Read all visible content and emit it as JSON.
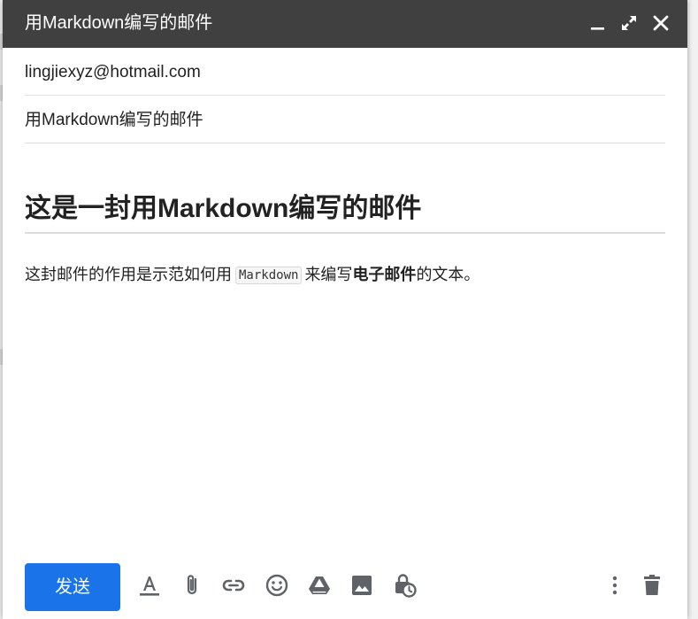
{
  "window": {
    "title": "用Markdown编写的邮件"
  },
  "controls": {
    "minimize_icon": "minimize-icon",
    "expand_icon": "expand-icon",
    "close_icon": "close-icon"
  },
  "fields": {
    "recipient": "lingjiexyz@hotmail.com",
    "subject": "用Markdown编写的邮件"
  },
  "body": {
    "heading": "这是一封用Markdown编写的邮件",
    "paragraph_before_code": "这封邮件的作用是示范如何用",
    "inline_code": "Markdown",
    "paragraph_middle": "来编写",
    "paragraph_bold": "电子邮件",
    "paragraph_after": "的文本。"
  },
  "toolbar": {
    "send_label": "发送",
    "icons": [
      "format-text-icon",
      "attach-icon",
      "link-icon",
      "emoji-icon",
      "drive-icon",
      "image-icon",
      "confidential-mode-icon",
      "more-options-icon",
      "trash-icon"
    ]
  },
  "colors": {
    "titlebar": "#404040",
    "send_button": "#1a73e8",
    "icon": "#5f6368"
  }
}
